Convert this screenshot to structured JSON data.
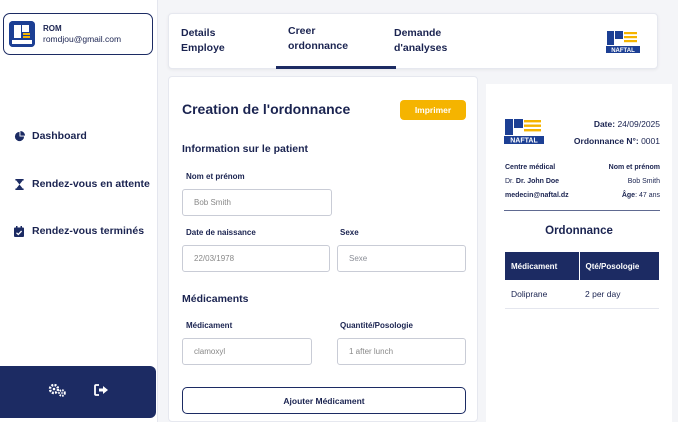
{
  "user": {
    "name": "ROM",
    "email": "romdjou@gmail.com"
  },
  "sidebar": {
    "items": [
      {
        "label": "Dashboard",
        "icon": "pie-chart-icon"
      },
      {
        "label": "Rendez-vous en attente",
        "icon": "hourglass-icon"
      },
      {
        "label": "Rendez-vous terminés",
        "icon": "calendar-check-icon"
      }
    ],
    "footer_icons": [
      "settings-icon",
      "logout-icon"
    ]
  },
  "tabs": [
    {
      "label_line1": "Details",
      "label_line2": "Employe"
    },
    {
      "label_line1": "Creer",
      "label_line2": "ordonnance",
      "active": true
    },
    {
      "label_line1": "Demande",
      "label_line2": "d'analyses"
    }
  ],
  "form": {
    "title": "Creation de l'ordonnance",
    "print_label": "Imprimer",
    "patient_section": "Information sur le patient",
    "name_label": "Nom et prénom",
    "name_value": "Bob Smith",
    "dob_label": "Date de naissance",
    "dob_value": "22/03/1978",
    "sex_label": "Sexe",
    "sex_placeholder": "Sexe",
    "meds_section": "Médicaments",
    "med_label": "Médicament",
    "med_value": "clamoxyl",
    "qty_label": "Quantité/Posologie",
    "qty_value": "1 after lunch",
    "add_label": "Ajouter Médicament"
  },
  "preview": {
    "date_label": "Date:",
    "date_value": "24/09/2025",
    "ord_label": "Ordonnance N°:",
    "ord_value": "0001",
    "center_label": "Centre médical",
    "doctor_prefix": "Dr.",
    "doctor_name": "Dr. John Doe",
    "center_email": "medecin@naftal.dz",
    "patient_label": "Nom et prénom",
    "patient_name": "Bob Smith",
    "age_label": "Âge",
    "age_value": ": 47 ans",
    "title": "Ordonnance",
    "table_headers": [
      "Médicament",
      "Qté/Posologie"
    ],
    "rows": [
      {
        "med": "Doliprane",
        "qty": "2 per day"
      }
    ]
  },
  "brand": {
    "name": "NAFTAL",
    "primary": "#1c3f94",
    "accent": "#f5b400",
    "navy": "#1c2b63"
  }
}
